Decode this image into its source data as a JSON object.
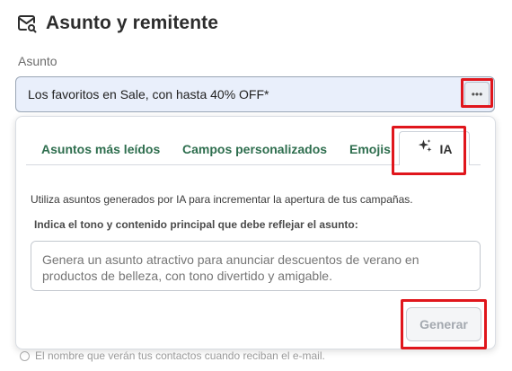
{
  "section": {
    "title": "Asunto y remitente",
    "icon": "mail-search-icon"
  },
  "subject": {
    "label": "Asunto",
    "value": "Los favoritos en Sale, con hasta 40% OFF*",
    "more_icon": "more-horizontal-icon",
    "more_glyph": "•••"
  },
  "tabs": [
    {
      "label": "Asuntos más leídos"
    },
    {
      "label": "Campos personalizados"
    },
    {
      "label": "Emojis"
    },
    {
      "label": "IA",
      "icon": "sparkle-icon",
      "active": true
    }
  ],
  "ia": {
    "description": "Utiliza asuntos generados por IA para incrementar la apertura de tus campañas.",
    "prompt_label": "Indica el tono y contenido principal que debe reflejar el asunto:",
    "prompt_placeholder": "Genera un asunto atractivo para anunciar descuentos de verano en productos de belleza, con tono divertido y amigable.",
    "generate_label": "Generar"
  },
  "hint_behind": "El nombre que verán tus contactos cuando reciban el e-mail.",
  "colors": {
    "highlight": "#e0161c",
    "tab_text": "#2e6e4e",
    "input_bg": "#e9effb"
  }
}
